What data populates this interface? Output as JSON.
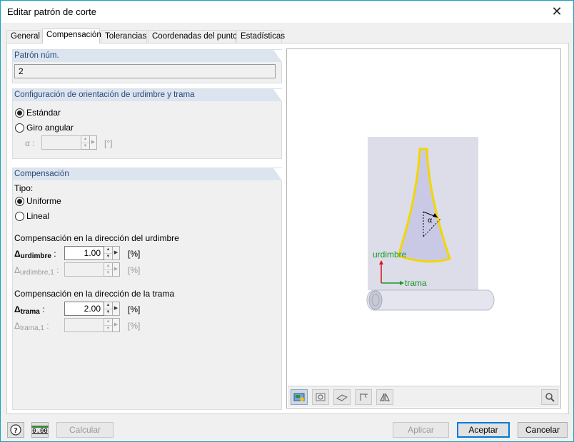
{
  "window": {
    "title": "Editar patrón de corte",
    "close_glyph": "✕"
  },
  "tabs": [
    {
      "label": "General"
    },
    {
      "label": "Compensación",
      "active": true
    },
    {
      "label": "Tolerancias"
    },
    {
      "label": "Coordenadas del punto"
    },
    {
      "label": "Estadísticas"
    }
  ],
  "pattern": {
    "header": "Patrón núm.",
    "value": "2"
  },
  "orientation": {
    "header": "Configuración de orientación de urdimbre y trama",
    "options": [
      {
        "label": "Estándar",
        "selected": true
      },
      {
        "label": "Giro angular",
        "selected": false
      }
    ],
    "alpha_label": "α :",
    "alpha_value": "",
    "alpha_unit": "[°]"
  },
  "compensation": {
    "header": "Compensación",
    "type_label": "Tipo:",
    "types": [
      {
        "label": "Uniforme",
        "selected": true
      },
      {
        "label": "Lineal",
        "selected": false
      }
    ],
    "warp_title": "Compensación en la dirección del urdimbre",
    "warp_symbol": "Δ",
    "warp_sub": "urdimbre",
    "warp_value": "1.00",
    "warp_unit": "[%]",
    "warp1_symbol": "Δ",
    "warp1_sub": "urdimbre,1",
    "warp1_value": "",
    "warp1_unit": "[%]",
    "weft_title": "Compensación en la dirección de la trama",
    "weft_symbol": "Δ",
    "weft_sub": "trama",
    "weft_value": "2.00",
    "weft_unit": "[%]",
    "weft1_symbol": "Δ",
    "weft1_sub": "trama,1",
    "weft1_value": "",
    "weft1_unit": "[%]"
  },
  "preview": {
    "warp_axis_label": "urdimbre",
    "weft_axis_label": "trama",
    "angle_label": "α",
    "colors": {
      "warp_axis": "#1a9a2a",
      "weft_axis": "#1a9a2a",
      "red_axis": "#e0101a",
      "pattern_outline": "#f2d600",
      "pattern_fill": "#c9c9e6",
      "roll": "#dcdde8"
    },
    "toolbar": [
      "view-icon",
      "settings-icon",
      "plane-icon",
      "axes-icon",
      "mirror-icon",
      "zoom-reset-icon"
    ]
  },
  "footer": {
    "help_icon": "help-icon",
    "calc_icon": "calculator-icon",
    "calc_icon_text": "0.00",
    "calculate_label": "Calcular",
    "apply_label": "Aplicar",
    "ok_label": "Aceptar",
    "cancel_label": "Cancelar"
  }
}
